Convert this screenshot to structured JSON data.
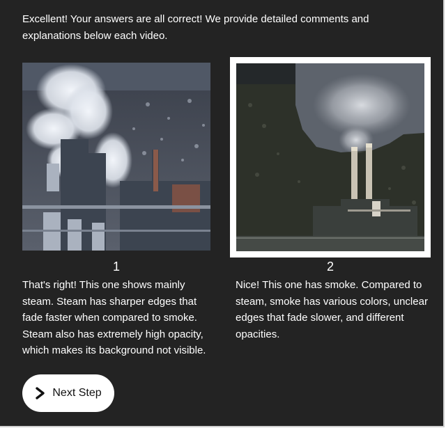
{
  "intro": {
    "text": "Excellent! Your answers are all correct! We provide detailed comments and explanations below each video."
  },
  "cards": [
    {
      "number": "1",
      "comment": "That's right! This one shows mainly steam. Steam has sharper edges that fade faster when compared to smoke. Steam also has extremely high opacity, which makes its background not visible.",
      "selected": false
    },
    {
      "number": "2",
      "comment": "Nice! This one has smoke. Compared to steam, smoke has various colors, unclear edges that fade slower, and different opacities.",
      "selected": true
    }
  ],
  "next_button": {
    "label": "Next Step",
    "icon": "chevron-right-icon"
  },
  "colors": {
    "panel_background": "#232323",
    "text": "#ffffff",
    "selection_border": "#ffffff",
    "button_background": "#ffffff",
    "button_text": "#111111"
  }
}
